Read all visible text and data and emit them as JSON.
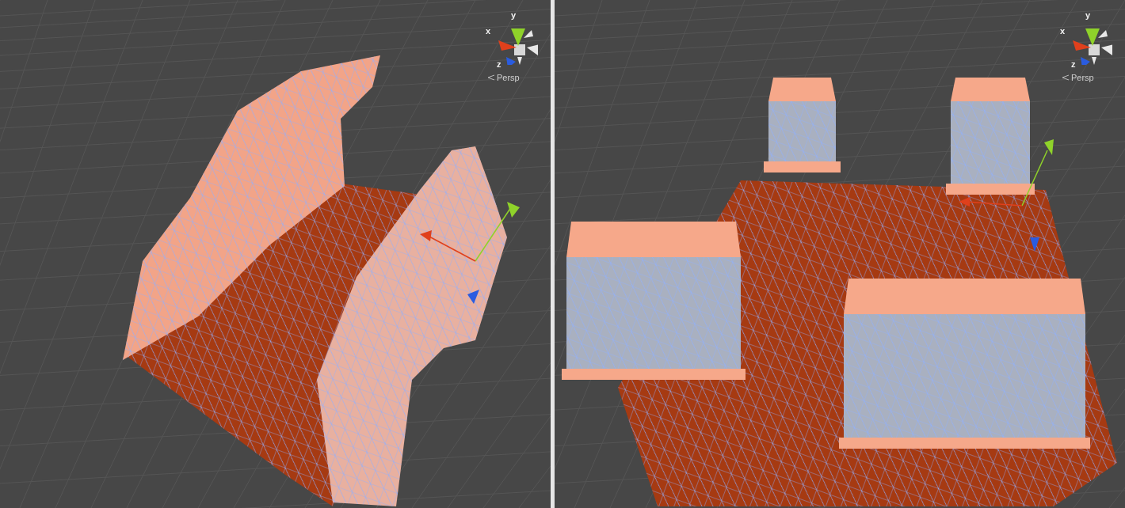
{
  "viewports": [
    {
      "mesh": {
        "kind": "terrain"
      },
      "gizmo": {
        "axes": [
          {
            "label": "y",
            "kind": "y",
            "color": "#8fd22a"
          },
          {
            "label": "x",
            "kind": "x",
            "color": "#e0401c"
          },
          {
            "label": "z",
            "kind": "z",
            "color": "#2a5ce0"
          }
        ]
      },
      "projection": "Persp"
    },
    {
      "mesh": {
        "kind": "room"
      },
      "gizmo": {
        "axes": [
          {
            "label": "y",
            "kind": "y",
            "color": "#8fd22a"
          },
          {
            "label": "x",
            "kind": "x",
            "color": "#e0401c"
          },
          {
            "label": "z",
            "kind": "z",
            "color": "#2a5ce0"
          }
        ]
      },
      "projection": "Persp"
    }
  ]
}
